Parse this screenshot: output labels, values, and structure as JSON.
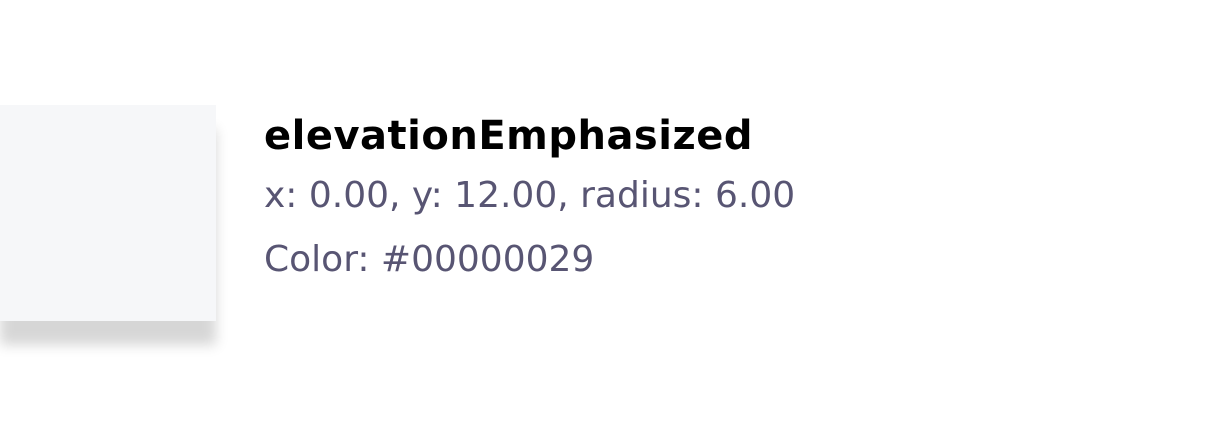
{
  "token": {
    "name": "elevationEmphasized",
    "values_text": "x: 0.00, y: 12.00, radius: 6.00",
    "color_text": "Color: #00000029"
  },
  "colors": {
    "swatch_fill": "#f6f7f9",
    "shadow": "#00000029",
    "title_text": "#000000",
    "detail_text": "#585573"
  }
}
